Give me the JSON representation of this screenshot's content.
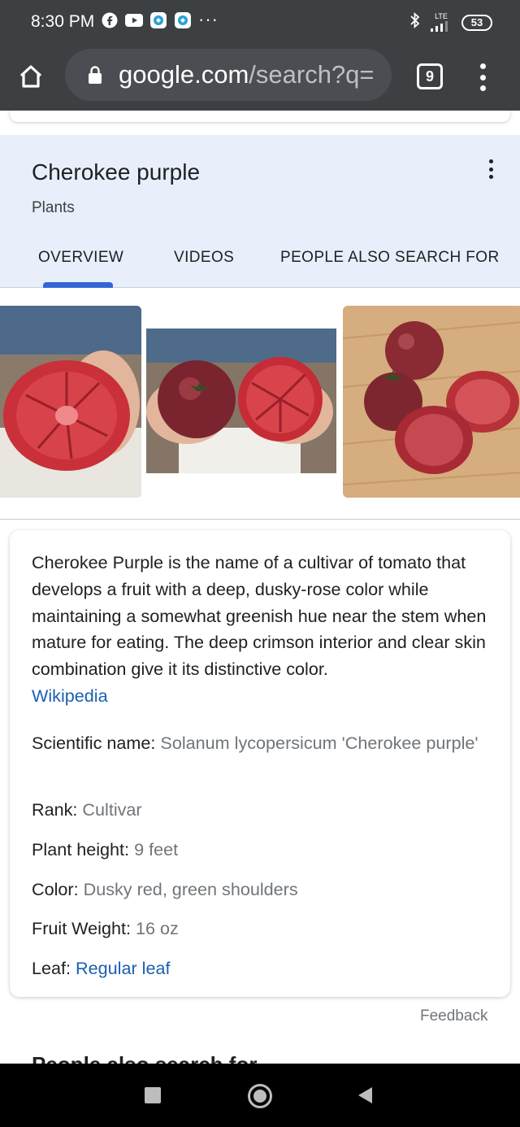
{
  "status_bar": {
    "time": "8:30 PM",
    "network": "LTE",
    "battery": "53",
    "icons": [
      "facebook-icon",
      "youtube-icon",
      "app-icon",
      "app-icon",
      "more-notifications-icon",
      "bluetooth-icon",
      "signal-icon",
      "battery-icon"
    ]
  },
  "browser": {
    "url_domain": "google.com",
    "url_path": "/search?q=",
    "tab_count": "9"
  },
  "knowledge_panel": {
    "title": "Cherokee purple",
    "subtitle": "Plants",
    "tabs": [
      {
        "label": "OVERVIEW"
      },
      {
        "label": "VIDEOS"
      },
      {
        "label": "PEOPLE ALSO SEARCH FOR"
      }
    ],
    "active_tab": "OVERVIEW"
  },
  "description": {
    "text": "Cherokee Purple is the name of a cultivar of tomato that develops a fruit with a deep, dusky-rose color while maintaining a somewhat greenish hue near the stem when mature for eating. The deep crimson interior and clear skin combination give it its distinctive color.",
    "source_link": "Wikipedia"
  },
  "facts": [
    {
      "label": "Scientific name:",
      "value": "Solanum lycopersicum 'Cherokee purple'"
    },
    {
      "label": "Rank:",
      "value": "Cultivar"
    },
    {
      "label": "Plant height:",
      "value": "9 feet"
    },
    {
      "label": "Color:",
      "value": "Dusky red, green shoulders"
    },
    {
      "label": "Fruit Weight:",
      "value": "16 oz"
    },
    {
      "label": "Leaf:",
      "value": "Regular leaf"
    }
  ],
  "feedback_label": "Feedback",
  "next_section_title": "People also search for",
  "colors": {
    "status_bar": "#3c4043",
    "panel_bg": "#e8effa",
    "accent": "#3367d6",
    "link": "#1a5fb4"
  }
}
